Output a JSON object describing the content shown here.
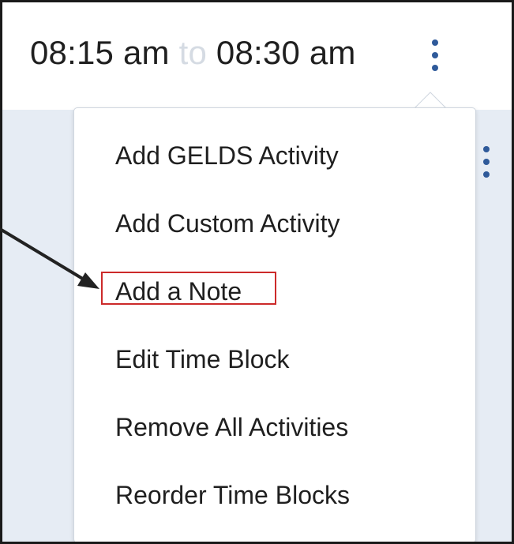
{
  "header": {
    "start_time": "08:15 am",
    "separator": "to",
    "end_time": "08:30 am",
    "menu_icon": "kebab-vertical-icon"
  },
  "body": {
    "menu_icon": "kebab-vertical-icon"
  },
  "menu": {
    "items": [
      {
        "label": "Add GELDS Activity"
      },
      {
        "label": "Add Custom Activity"
      },
      {
        "label": "Add a Note"
      },
      {
        "label": "Edit Time Block"
      },
      {
        "label": "Remove All Activities"
      },
      {
        "label": "Reorder Time Blocks"
      }
    ],
    "highlighted_index": 2
  },
  "colors": {
    "icon": "#2f5a9a",
    "body_background": "#e6ecf4",
    "highlight_border": "#cc2a2a",
    "arrow": "#222222",
    "separator_text": "#d5dbe3"
  }
}
